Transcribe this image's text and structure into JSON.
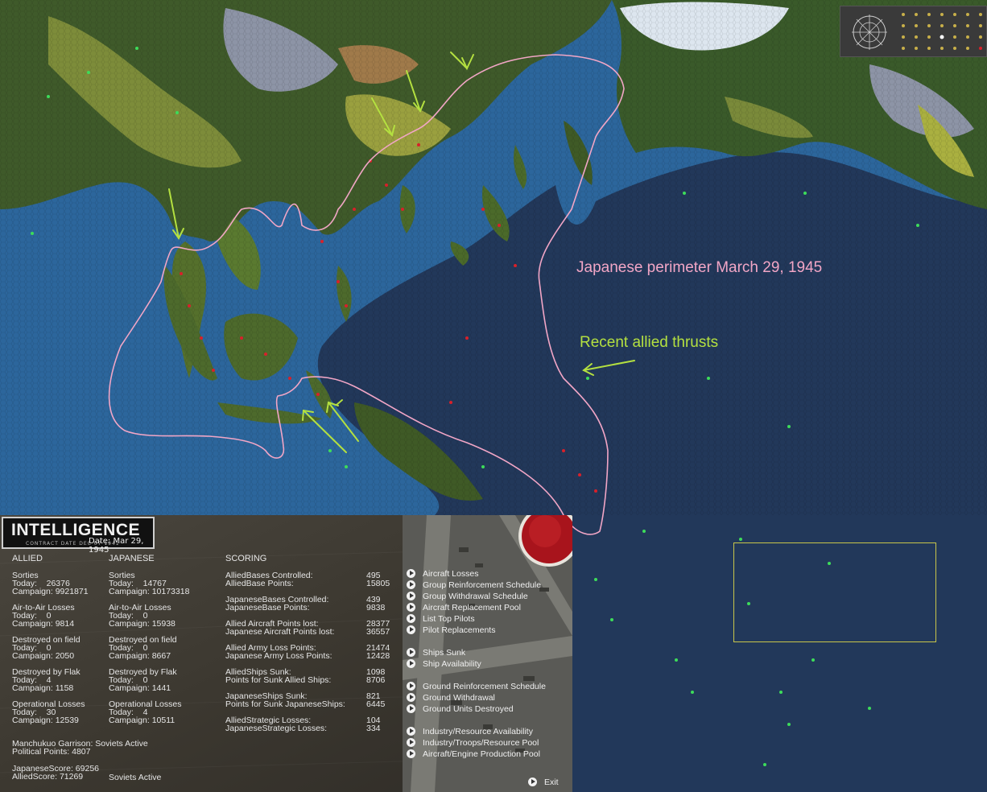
{
  "annotations": {
    "perimeter": "Japanese perimeter March 29, 1945",
    "thrusts": "Recent allied thrusts"
  },
  "colors": {
    "ocean": "#22385a",
    "shallow_water": "#2e6fa8",
    "jungle": "#3a5a2a",
    "plains": "#7a8a3a",
    "arctic": "#dde6ef",
    "perimeter_line": "#f2a6c6",
    "thrust_arrows": "#b4e040",
    "selection_box": "#c9c54a",
    "allied_base": "#3ddc5a",
    "japanese_base": "#d8202a"
  },
  "intelligence": {
    "title": "INTELLIGENCE",
    "subtitle": "CONTRACT DATE DEC 07 1941",
    "date": "Date: Mar 29, 1945",
    "allied": {
      "header": "ALLIED",
      "sorties": "Sorties\nToday:    26376\nCampaign: 9921871",
      "air_to_air": "Air-to-Air Losses\nToday:    0\nCampaign: 9814",
      "destroyed_field": "Destroyed on field\nToday:    0\nCampaign: 2050",
      "destroyed_flak": "Destroyed by Flak\nToday:    4\nCampaign: 1158",
      "operational": "Operational Losses\nToday:    30\nCampaign: 12539"
    },
    "japanese": {
      "header": "JAPANESE",
      "sorties": "Sorties\nToday:    14767\nCampaign: 10173318",
      "air_to_air": "Air-to-Air Losses\nToday:    0\nCampaign: 15938",
      "destroyed_field": "Destroyed on field\nToday:    0\nCampaign: 8667",
      "destroyed_flak": "Destroyed by Flak\nToday:    0\nCampaign: 1441",
      "operational": "Operational Losses\nToday:    4\nCampaign: 10511"
    },
    "scoring": {
      "header": "SCORING",
      "labels_1": "AlliedBases Controlled:\nAlliedBase Points:",
      "values_1": "495\n15805",
      "labels_2": "JapaneseBases Controlled:\nJapaneseBase Points:",
      "values_2": "439\n9838",
      "labels_3": "Allied Aircraft Points lost:\nJapanese Aircraft Points lost:",
      "values_3": "28377\n36557",
      "labels_4": "Allied Army Loss Points:\nJapanese Army Loss Points:",
      "values_4": "21474\n12428",
      "labels_5": "AlliedShips Sunk:\nPoints for Sunk Allied Ships:",
      "values_5": "1098\n8706",
      "labels_6": "JapaneseShips Sunk:\nPoints for Sunk JapaneseShips:",
      "values_6": "821\n6445",
      "labels_7": "AlliedStrategic Losses:\nJapaneseStrategic Losses:",
      "values_7": "104\n334"
    },
    "garrison": "Manchukuo Garrison: Soviets Active\nPolitical Points: 4807",
    "scores": "JapaneseScore: 69256\nAlliedScore: 71269",
    "soviets": "Soviets Active",
    "menu": [
      "Aircraft Losses",
      "Group Reinforcement Schedule",
      "Group Withdrawal Schedule",
      "Aircraft Replacement Pool",
      "List Top Pilots",
      "Pilot Replacements",
      "Ships Sunk",
      "Ship Availability",
      "Ground Reinforcement Schedule",
      "Ground Withdrawal",
      "Ground Units Destroyed",
      "Industry/Resource Availability",
      "Industry/Troops/Resource Pool",
      "Aircraft/Engine Production Pool"
    ],
    "exit": "Exit"
  }
}
